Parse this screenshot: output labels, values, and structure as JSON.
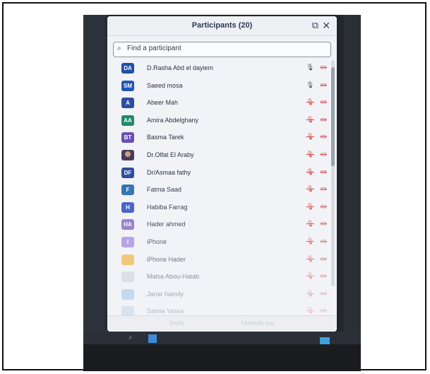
{
  "panel": {
    "title": "Participants (20)",
    "popout_icon": "popout-icon",
    "close_icon": "close-icon"
  },
  "search": {
    "placeholder": "Find a participant",
    "icon": "search-icon"
  },
  "participants": [
    {
      "initials": "DA",
      "name": "D.Rasha Abd el dayiem",
      "color": "#1f4fa8",
      "mic": "on",
      "video": "off"
    },
    {
      "initials": "SM",
      "name": "Saeed mosa",
      "color": "#2457b4",
      "mic": "on",
      "video": "off"
    },
    {
      "initials": "A",
      "name": "Abeer Mah",
      "color": "#2a4fa2",
      "mic": "muted",
      "video": "off"
    },
    {
      "initials": "AA",
      "name": "Amira Abdelghany",
      "color": "#1f8a6f",
      "mic": "muted",
      "video": "off"
    },
    {
      "initials": "BT",
      "name": "Basma Tarek",
      "color": "#6a4fb8",
      "mic": "muted",
      "video": "off"
    },
    {
      "initials": "",
      "name": "Dr.Olfat El Araby",
      "color": "photo",
      "mic": "muted",
      "video": "off"
    },
    {
      "initials": "DF",
      "name": "Dr/Asmaa fathy",
      "color": "#2e4f9e",
      "mic": "muted",
      "video": "off"
    },
    {
      "initials": "F",
      "name": "Fatma Saad",
      "color": "#2f6fb0",
      "mic": "muted",
      "video": "off"
    },
    {
      "initials": "H",
      "name": "Habiba Farrag",
      "color": "#3856c4",
      "mic": "muted",
      "video": "off"
    },
    {
      "initials": "HA",
      "name": "Hader ahmed",
      "color": "#8a6fc8",
      "mic": "muted",
      "video": "off"
    },
    {
      "initials": "I",
      "name": "iPhone",
      "color": "#a58ae0",
      "mic": "muted",
      "video": "off"
    },
    {
      "initials": "",
      "name": "iPhone Hader",
      "color": "#f0b23a",
      "mic": "muted",
      "video": "off"
    },
    {
      "initials": "",
      "name": "Malsa Abou-Hatab",
      "color": "#c9ccd2",
      "mic": "muted",
      "video": "off"
    },
    {
      "initials": "",
      "name": "Janar hamdy",
      "color": "#7fb0e6",
      "mic": "muted",
      "video": "off"
    },
    {
      "initials": "",
      "name": "Samia Yassa",
      "color": "#9cc0e8",
      "mic": "muted",
      "video": "off"
    }
  ],
  "footer": {
    "invite_label": "Invite",
    "unmute_label": "Unmute me"
  },
  "colors": {
    "muted_icon": "#d44a4a",
    "active_mic": "#444444"
  }
}
